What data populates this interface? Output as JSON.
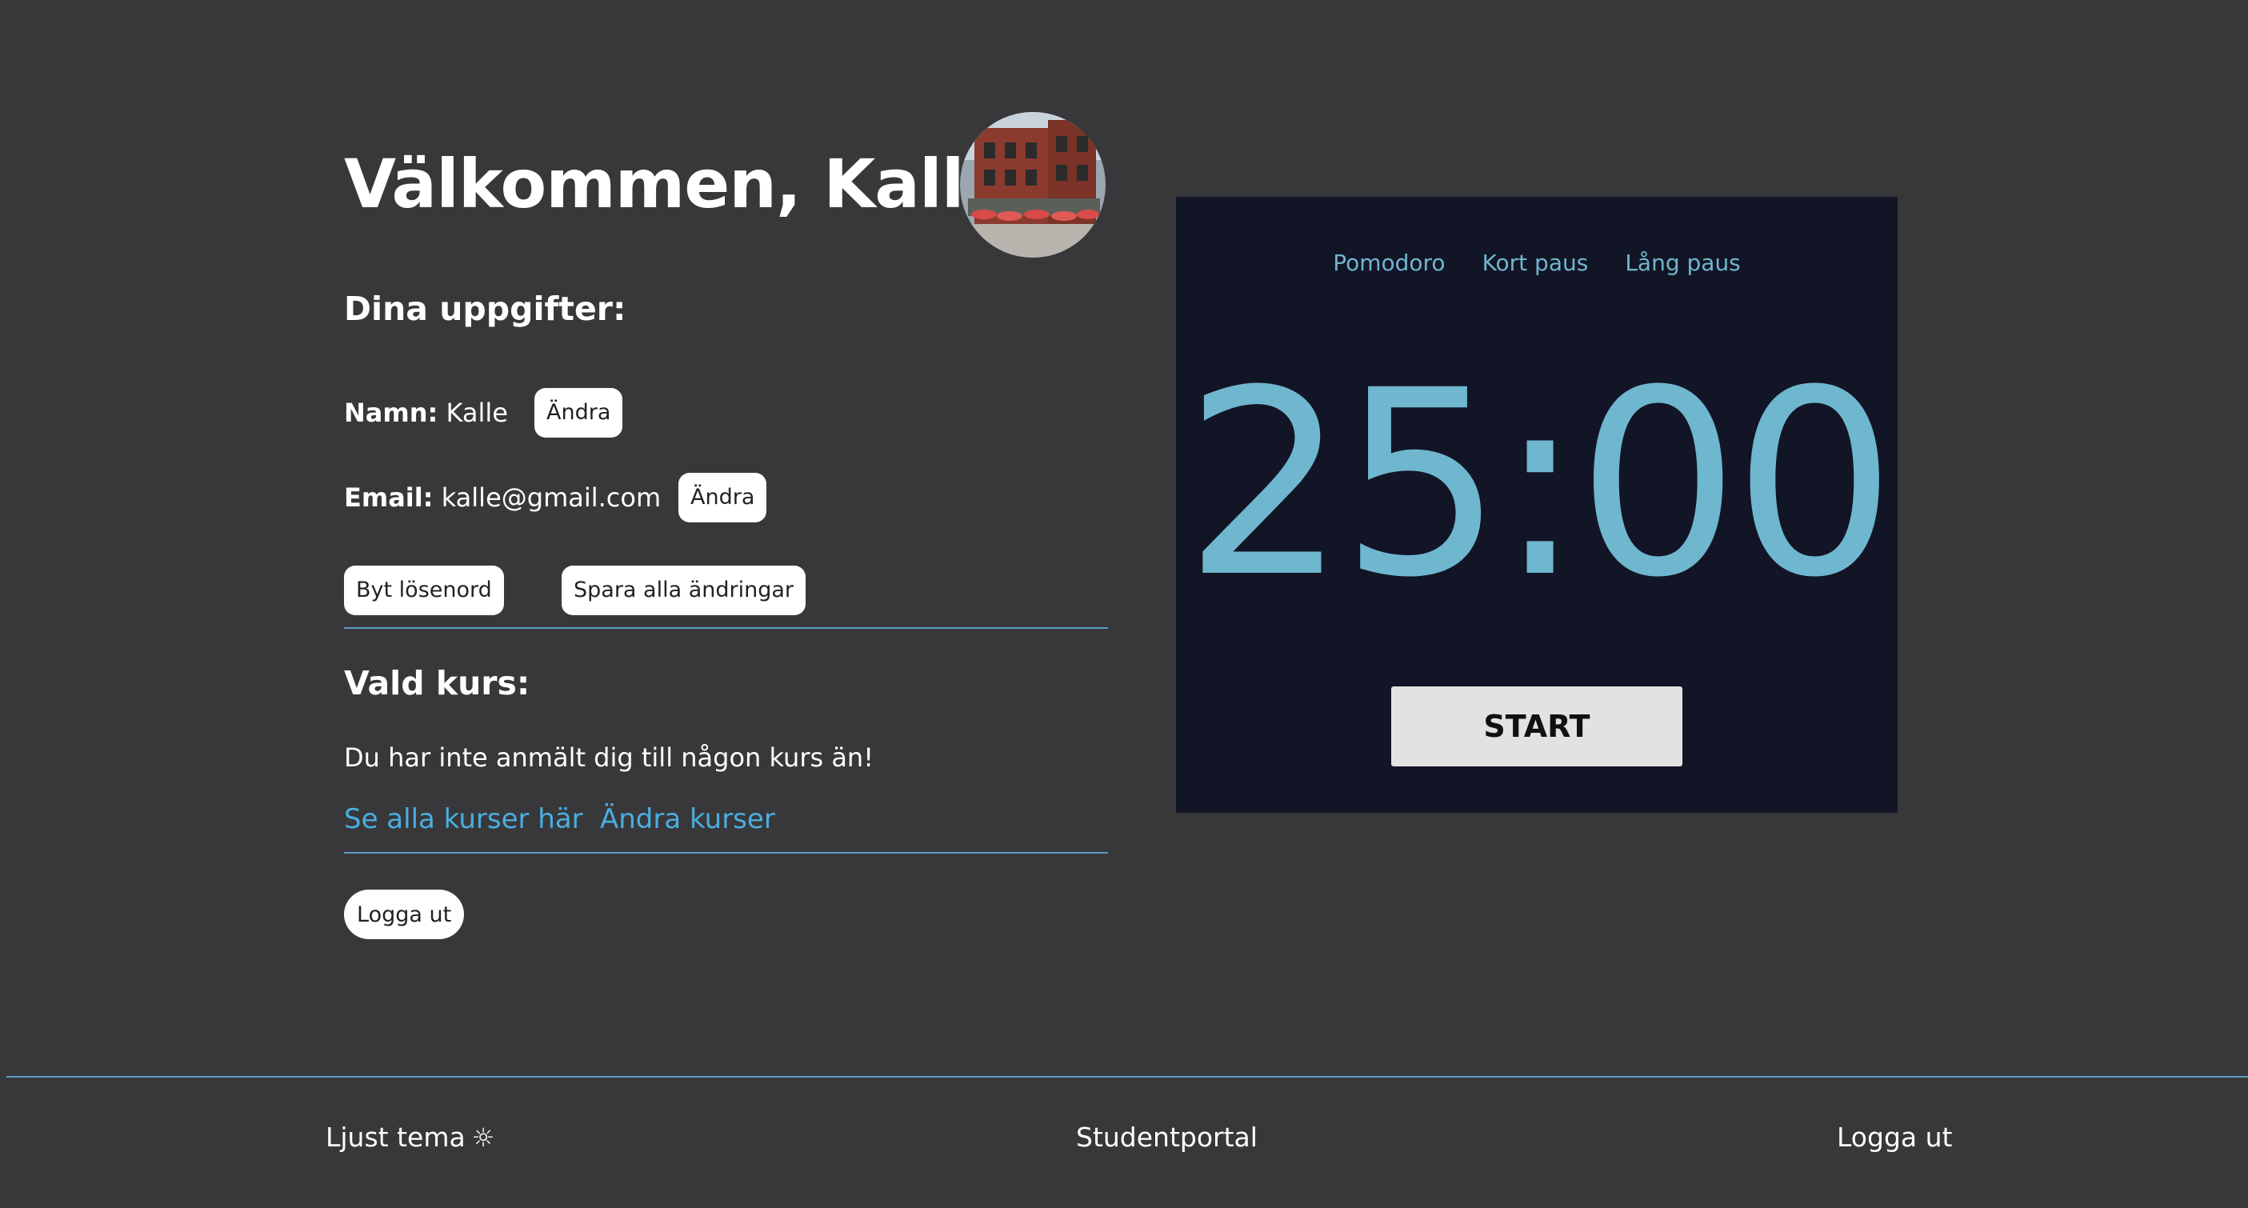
{
  "profile": {
    "welcome_title": "Välkommen, Kalle",
    "avatar_icon": "building-photo-avatar",
    "details_heading": "Dina uppgifter:",
    "name_label": "Namn:",
    "name_value": "Kalle",
    "email_label": "Email:",
    "email_value": "kalle@gmail.com",
    "edit_label": "Ändra",
    "change_password_label": "Byt lösenord",
    "save_all_label": "Spara alla ändringar",
    "course_heading": "Vald kurs:",
    "no_course_text": "Du har inte anmält dig till någon kurs än!",
    "see_courses_link": "Se alla kurser här",
    "change_courses_link": "Ändra kurser",
    "logout_label": "Logga ut"
  },
  "timer": {
    "tabs": [
      "Pomodoro",
      "Kort paus",
      "Lång paus"
    ],
    "display": "25:00",
    "start_label": "START",
    "accent_color": "#6fb6cf",
    "panel_color": "#121526"
  },
  "footer": {
    "theme_label": "Ljust tema",
    "theme_icon": "sun-icon",
    "theme_glyph": "☼",
    "portal_label": "Studentportal",
    "logout_label": "Logga ut"
  },
  "colors": {
    "background": "#38383a",
    "link": "#4aaee0",
    "divider": "#5a9cc4"
  }
}
